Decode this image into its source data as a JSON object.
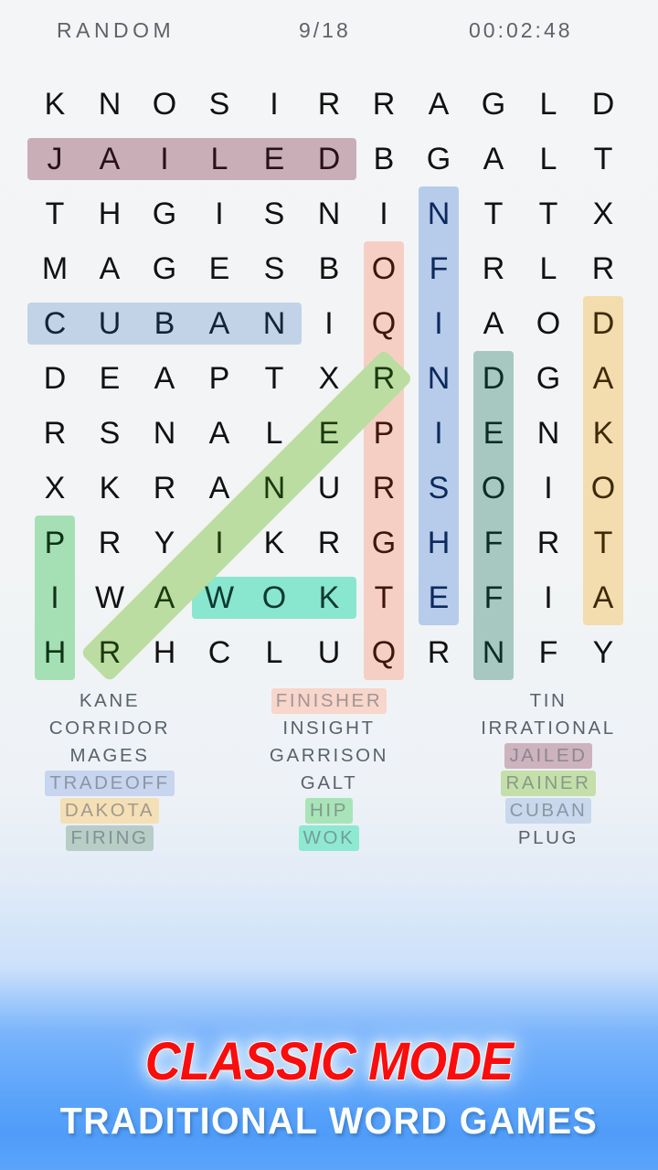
{
  "header": {
    "mode_label": "RANDOM",
    "progress": "9/18",
    "timer": "00:02:48"
  },
  "grid": {
    "rows": 11,
    "cols": 11,
    "letters": [
      [
        "K",
        "N",
        "O",
        "S",
        "I",
        "R",
        "R",
        "A",
        "G",
        "L",
        "D"
      ],
      [
        "J",
        "A",
        "I",
        "L",
        "E",
        "D",
        "B",
        "G",
        "A",
        "L",
        "T"
      ],
      [
        "T",
        "H",
        "G",
        "I",
        "S",
        "N",
        "I",
        "N",
        "T",
        "T",
        "X"
      ],
      [
        "M",
        "A",
        "G",
        "E",
        "S",
        "B",
        "O",
        "F",
        "R",
        "L",
        "R"
      ],
      [
        "C",
        "U",
        "B",
        "A",
        "N",
        "I",
        "Q",
        "I",
        "A",
        "O",
        "D"
      ],
      [
        "D",
        "E",
        "A",
        "P",
        "T",
        "X",
        "R",
        "N",
        "D",
        "G",
        "A"
      ],
      [
        "R",
        "S",
        "N",
        "A",
        "L",
        "E",
        "P",
        "I",
        "E",
        "N",
        "K"
      ],
      [
        "X",
        "K",
        "R",
        "A",
        "N",
        "U",
        "R",
        "S",
        "O",
        "I",
        "O"
      ],
      [
        "P",
        "R",
        "Y",
        "I",
        "K",
        "R",
        "G",
        "H",
        "F",
        "R",
        "T"
      ],
      [
        "I",
        "W",
        "A",
        "W",
        "O",
        "K",
        "T",
        "E",
        "F",
        "I",
        "A"
      ],
      [
        "H",
        "R",
        "H",
        "C",
        "L",
        "U",
        "Q",
        "R",
        "N",
        "F",
        "Y"
      ]
    ],
    "highlights": [
      {
        "word": "JAILED",
        "color": "#c9aeb8",
        "orientation": "horizontal",
        "row": 1,
        "col_start": 0,
        "col_end": 5,
        "letter_color": "#2a1118"
      },
      {
        "word": "CUBAN",
        "color": "#c2d3e8",
        "orientation": "horizontal",
        "row": 4,
        "col_start": 0,
        "col_end": 4,
        "letter_color": "#13243a"
      },
      {
        "word": "WOK",
        "color": "#89e6cf",
        "orientation": "horizontal",
        "row": 9,
        "col_start": 3,
        "col_end": 5,
        "letter_color": "#0c3a30"
      },
      {
        "word": "FINISHER",
        "color": "#f6cfc4",
        "orientation": "vertical",
        "col": 6,
        "row_start": 3,
        "row_end": 10,
        "letter_color": "#41150b"
      },
      {
        "word": "TRADEOFF",
        "color": "#b7cbeb",
        "orientation": "vertical",
        "col": 7,
        "row_start": 2,
        "row_end": 9,
        "letter_color": "#0d2a5c"
      },
      {
        "word": "FIRING",
        "color": "#a7c8c0",
        "orientation": "vertical",
        "col": 8,
        "row_start": 5,
        "row_end": 10,
        "letter_color": "#0d2c25"
      },
      {
        "word": "DAKOTA",
        "color": "#f3dcad",
        "orientation": "vertical",
        "col": 10,
        "row_start": 4,
        "row_end": 9,
        "letter_color": "#3d2a05"
      },
      {
        "word": "HIP",
        "color": "#a5e0b4",
        "orientation": "vertical",
        "col": 0,
        "row_start": 8,
        "row_end": 10,
        "letter_color": "#0d3317"
      },
      {
        "word": "RAINER",
        "color": "#bcdda1",
        "orientation": "diagonal",
        "row_start": 10,
        "col_start": 1,
        "row_end": 5,
        "col_end": 6,
        "letter_color": "#1b3a0d"
      }
    ]
  },
  "word_list": {
    "columns": [
      [
        {
          "text": "KANE",
          "found": false,
          "color": null
        },
        {
          "text": "CORRIDOR",
          "found": false,
          "color": null
        },
        {
          "text": "MAGES",
          "found": false,
          "color": null
        },
        {
          "text": "TRADEOFF",
          "found": true,
          "color": "#c7d5ee"
        },
        {
          "text": "DAKOTA",
          "found": true,
          "color": "#f5dfb6"
        },
        {
          "text": "FIRING",
          "found": true,
          "color": "#b7cdc6"
        }
      ],
      [
        {
          "text": "FINISHER",
          "found": true,
          "color": "#f8d6cb"
        },
        {
          "text": "INSIGHT",
          "found": false,
          "color": null
        },
        {
          "text": "GARRISON",
          "found": false,
          "color": null
        },
        {
          "text": "GALT",
          "found": false,
          "color": null
        },
        {
          "text": "HIP",
          "found": true,
          "color": "#a9e4b8"
        },
        {
          "text": "WOK",
          "found": true,
          "color": "#8fe8d2"
        }
      ],
      [
        {
          "text": "TIN",
          "found": false,
          "color": null
        },
        {
          "text": "IRRATIONAL",
          "found": false,
          "color": null
        },
        {
          "text": "JAILED",
          "found": true,
          "color": "#cdb3bd"
        },
        {
          "text": "RAINER",
          "found": true,
          "color": "#c4dfaa"
        },
        {
          "text": "CUBAN",
          "found": true,
          "color": "#c9d8ec"
        },
        {
          "text": "PLUG",
          "found": false,
          "color": null
        }
      ]
    ]
  },
  "banner": {
    "title": "CLASSIC MODE",
    "subtitle": "TRADITIONAL WORD GAMES",
    "title_color": "#fb0d0d",
    "subtitle_color": "#ffffff"
  }
}
